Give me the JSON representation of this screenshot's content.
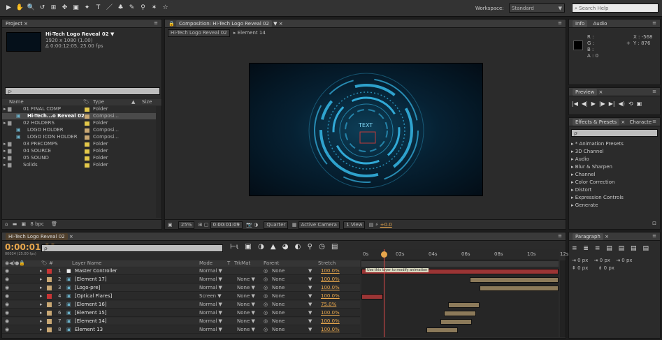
{
  "toolbar": {
    "tools": [
      "▶",
      "✋",
      "🔍",
      "↺",
      "⊞",
      "✥",
      "▣",
      "✦",
      "T",
      "／",
      "♣",
      "✎",
      "⚲",
      "✶",
      "☆"
    ],
    "workspace_label": "Workspace:",
    "workspace_value": "Standard",
    "search_placeholder": "Search Help"
  },
  "project": {
    "tab": "Project",
    "comp_name": "Hi-Tech Logo Reveal 02 ▼",
    "comp_res": "1920 x 1080 (1.00)",
    "comp_dur": "Δ 0:00:12:05, 25.00 fps",
    "search_placeholder": "ρ·",
    "col_name": "Name",
    "col_type": "Type",
    "col_size": "Size",
    "items": [
      {
        "name": "01 FINAL COMP",
        "type": "Folder",
        "color": "#e3c84a",
        "kind": "folder",
        "indent": 0
      },
      {
        "name": "Hi-Tech...o Reveal 02",
        "type": "Composi...",
        "color": "#c9a874",
        "kind": "comp",
        "indent": 1
      },
      {
        "name": "02 HOLDERS",
        "type": "Folder",
        "color": "#e3c84a",
        "kind": "folder",
        "indent": 0
      },
      {
        "name": "LOGO HOLDER",
        "type": "Composi...",
        "color": "#c9a874",
        "kind": "comp",
        "indent": 1
      },
      {
        "name": "LOGO ICON HOLDER",
        "type": "Composi...",
        "color": "#c9a874",
        "kind": "comp",
        "indent": 1
      },
      {
        "name": "03 PRECOMPS",
        "type": "Folder",
        "color": "#e3c84a",
        "kind": "folder",
        "indent": 0
      },
      {
        "name": "04 SOURCE",
        "type": "Folder",
        "color": "#e3c84a",
        "kind": "folder",
        "indent": 0
      },
      {
        "name": "05 SOUND",
        "type": "Folder",
        "color": "#e3c84a",
        "kind": "folder",
        "indent": 0
      },
      {
        "name": "Solids",
        "type": "Folder",
        "color": "#e3c84a",
        "kind": "folder",
        "indent": 0
      }
    ],
    "bpc": "8 bpc"
  },
  "composition": {
    "tab": "Composition: Hi-Tech Logo Reveal 02",
    "breadcrumb_comp": "Hi-Tech Logo Reveal 02",
    "breadcrumb_element": "Element 14",
    "viewer_logo_text": "TEXT",
    "zoom": "25%",
    "timecode": "0:00:01:09",
    "resolution": "Quarter",
    "camera": "Active Camera",
    "views": "1 View",
    "exposure": "+0.0"
  },
  "info": {
    "tab_info": "Info",
    "tab_audio": "Audio",
    "r": "R :",
    "g": "G :",
    "b": "B :",
    "a": "A : 0",
    "x": "X : -568",
    "y": "Y : 876"
  },
  "preview": {
    "tab": "Preview",
    "controls": [
      "|◀",
      "◀|",
      "▶",
      "|▶",
      "▶|",
      "◀)",
      "⟲",
      "▣"
    ]
  },
  "effects": {
    "tab": "Effects & Presets",
    "tab2": "Characte",
    "search_placeholder": "ρ·",
    "items": [
      "▸ * Animation Presets",
      "▸ 3D Channel",
      "▸ Audio",
      "▸ Blur & Sharpen",
      "▸ Channel",
      "▸ Color Correction",
      "▸ Distort",
      "▸ Expression Controls",
      "▸ Generate"
    ]
  },
  "paragraph": {
    "tab": "Paragraph",
    "indent_fields": [
      "⇥ 0 px",
      "⇥ 0 px",
      "⇥ 0 px"
    ],
    "space_fields": [
      "⇞ 0 px",
      "⇟ 0 px"
    ]
  },
  "timeline": {
    "tab": "Hi-Tech Logo Reveal 02",
    "timecode": "0:00:01:09",
    "frame_info": "00034 (25.00 fps)",
    "search_placeholder": "ρ·",
    "col_layer_name": "Layer Name",
    "col_mode": "Mode",
    "col_t": "T",
    "col_trkmat": "TrkMat",
    "col_parent": "Parent",
    "col_stretch": "Stretch",
    "ruler": [
      "0s",
      "02s",
      "04s",
      "06s",
      "08s",
      "10s",
      "12s"
    ],
    "tooltip": "Use this layer to modify animation",
    "layers": [
      {
        "num": "1",
        "name": "Master Controller",
        "mode": "Normal ▼",
        "trkmat": "",
        "parent": "None",
        "stretch": "100.0%",
        "color": "#c83535",
        "bar_start": 0.0,
        "bar_end": 1.0
      },
      {
        "num": "2",
        "name": "[Element 17]",
        "mode": "Normal ▼",
        "trkmat": "None ▼",
        "parent": "None",
        "stretch": "100.0%",
        "color": "#c9a874",
        "bar_start": 0.55,
        "bar_end": 1.0
      },
      {
        "num": "3",
        "name": "[Logo-pre]",
        "mode": "Normal ▼",
        "trkmat": "None ▼",
        "parent": "None",
        "stretch": "100.0%",
        "color": "#c9a874",
        "bar_start": 0.6,
        "bar_end": 1.0
      },
      {
        "num": "4",
        "name": "[Optical Flares]",
        "mode": "Screen ▼",
        "trkmat": "None ▼",
        "parent": "None",
        "stretch": "100.0%",
        "color": "#c83535",
        "bar_start": 0.0,
        "bar_end": 0.11
      },
      {
        "num": "5",
        "name": "[Element 16]",
        "mode": "Normal ▼",
        "trkmat": "None ▼",
        "parent": "None",
        "stretch": "75.0%",
        "color": "#c9a874",
        "bar_start": 0.44,
        "bar_end": 0.6
      },
      {
        "num": "6",
        "name": "[Element 15]",
        "mode": "Normal ▼",
        "trkmat": "None ▼",
        "parent": "None",
        "stretch": "100.0%",
        "color": "#c9a874",
        "bar_start": 0.42,
        "bar_end": 0.58
      },
      {
        "num": "7",
        "name": "[Element 14]",
        "mode": "Normal ▼",
        "trkmat": "None ▼",
        "parent": "None",
        "stretch": "100.0%",
        "color": "#c9a874",
        "bar_start": 0.4,
        "bar_end": 0.56
      },
      {
        "num": "8",
        "name": "Element 13",
        "mode": "Normal ▼",
        "trkmat": "None ▼",
        "parent": "None",
        "stretch": "100.0%",
        "color": "#c9a874",
        "bar_start": 0.33,
        "bar_end": 0.49
      }
    ],
    "playhead_fraction": 0.113
  },
  "colors": {
    "accent_orange": "#e7a64c",
    "timecode": "#e7a64c",
    "ring_blue": "#36b8e8"
  }
}
